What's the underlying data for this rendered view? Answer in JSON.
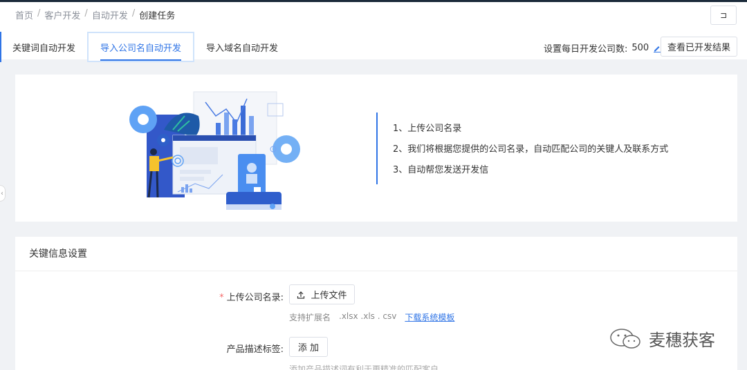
{
  "breadcrumb": [
    "首页",
    "客户开发",
    "自动开发",
    "创建任务"
  ],
  "collapse_icon": "⊐",
  "tabs": [
    "关键词自动开发",
    "导入公司名自动开发",
    "导入域名自动开发"
  ],
  "active_tab": 1,
  "daily_setting": {
    "label": "设置每日开发公司数:",
    "value": "500"
  },
  "view_results_label": "查看已开发结果",
  "steps": [
    "1、上传公司名录",
    "2、我们将根据您提供的公司名录，自动匹配公司的关键人及联系方式",
    "3、自动帮您发送开发信"
  ],
  "section": {
    "title": "关键信息设置",
    "upload_label": "上传公司名录:",
    "upload_button": "上传文件",
    "hint_prefix": "支持扩展名",
    "hint_ext": ".xlsx .xls . csv",
    "download_link": "下载系统模板",
    "tag_label": "产品描述标签:",
    "add_button": "添 加",
    "cut_hint": "添加产品描述词有利于更精准的匹配客户"
  },
  "watermark": "麦穗获客",
  "colors": {
    "accent": "#2f74e6",
    "required": "#f56c6c"
  }
}
